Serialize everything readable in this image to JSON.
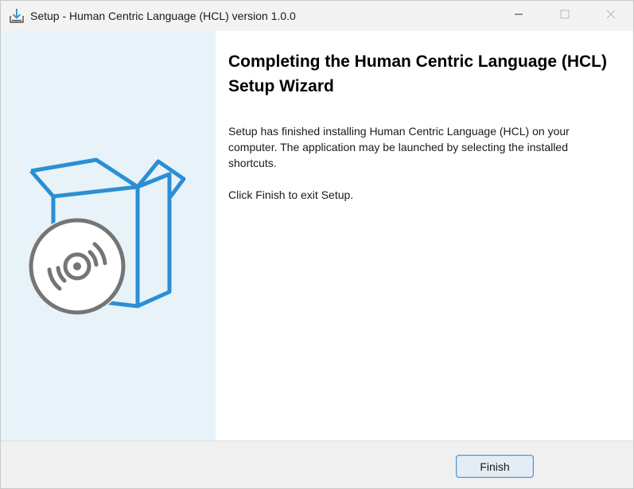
{
  "window": {
    "title": "Setup - Human Centric Language (HCL) version 1.0.0",
    "icon": "installer-download-icon"
  },
  "controls": {
    "minimize_icon": "minimize-icon",
    "maximize_icon": "maximize-icon",
    "close_icon": "close-icon"
  },
  "side_panel": {
    "image": "box-with-disc-illustration"
  },
  "content": {
    "heading": "Completing the Human Centric Language (HCL) Setup Wizard",
    "paragraph1": "Setup has finished installing Human Centric Language (HCL) on your computer. The application may be launched by selecting the installed shortcuts.",
    "paragraph2": "Click Finish to exit Setup."
  },
  "footer": {
    "finish_label": "Finish"
  },
  "colors": {
    "accent": "#2b8fd4",
    "side_panel_bg": "#e8f2f9",
    "disc_gray": "#757575",
    "button_border": "#4a90d9"
  }
}
